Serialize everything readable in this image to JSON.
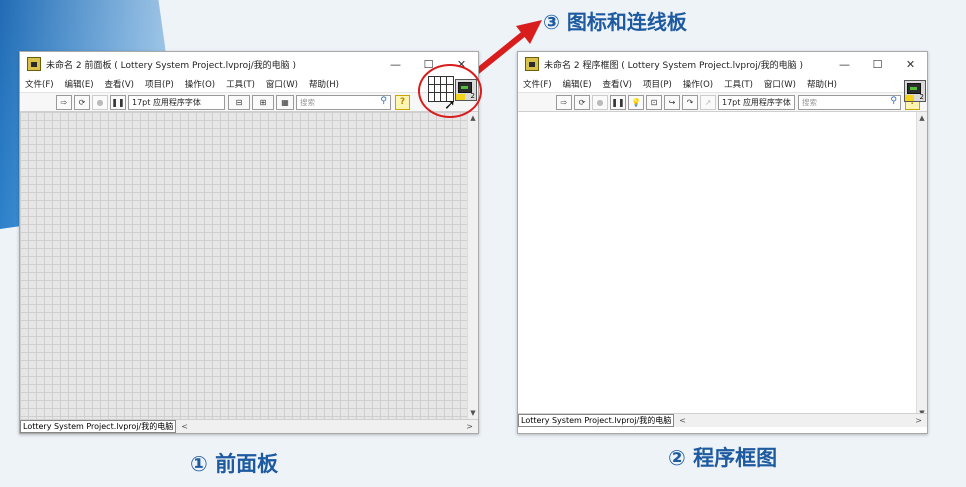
{
  "step3_caption": "③ 图标和连线板",
  "front_panel": {
    "title": "未命名 2 前面板 ( Lottery System Project.lvproj/我的电脑 )",
    "menus": [
      "文件(F)",
      "编辑(E)",
      "查看(V)",
      "项目(P)",
      "操作(O)",
      "工具(T)",
      "窗口(W)",
      "帮助(H)"
    ],
    "font_select": "17pt 应用程序字体",
    "search_placeholder": "搜索",
    "status_path": "Lottery System Project.lvproj/我的电脑",
    "icon_number": "2",
    "caption": "① 前面板"
  },
  "block_diagram": {
    "title": "未命名 2 程序框图 ( Lottery System Project.lvproj/我的电脑 )",
    "menus": [
      "文件(F)",
      "编辑(E)",
      "查看(V)",
      "项目(P)",
      "操作(O)",
      "工具(T)",
      "窗口(W)",
      "帮助(H)"
    ],
    "font_select": "17pt 应用程序字体",
    "search_placeholder": "搜索",
    "status_path": "Lottery System Project.lvproj/我的电脑",
    "icon_number": "2",
    "caption": "② 程序框图"
  },
  "window_controls": {
    "minimize": "—",
    "maximize": "☐",
    "close": "✕"
  },
  "scroll_glyphs": {
    "left": "<",
    "right": ">",
    "up": "▲",
    "down": "▼"
  },
  "colors": {
    "accent_blue": "#1d5aa0",
    "highlight_red": "#d91d1d"
  }
}
